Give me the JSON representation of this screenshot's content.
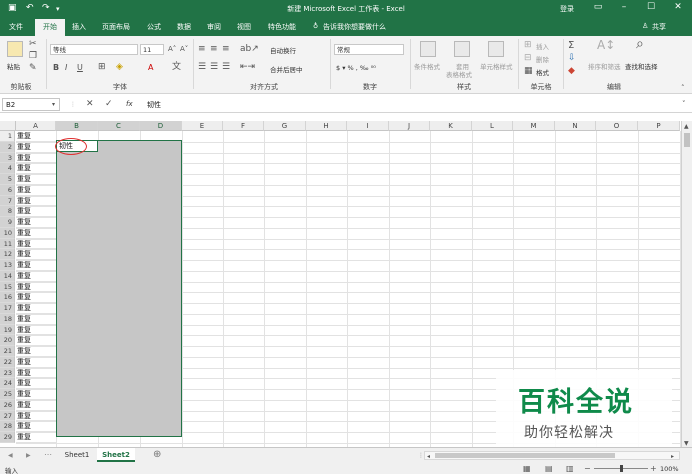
{
  "window": {
    "title": "新建 Microsoft Excel 工作表 - Excel",
    "login": "登录",
    "share": "共享"
  },
  "tabs": [
    "文件",
    "开始",
    "插入",
    "页面布局",
    "公式",
    "数据",
    "审阅",
    "视图",
    "特色功能"
  ],
  "active_tab": "开始",
  "tell_me": "告诉我你想要做什么",
  "ribbon": {
    "clipboard": {
      "paste": "粘贴",
      "label": "剪贴板"
    },
    "font": {
      "name": "等线",
      "size": "11",
      "label": "字体"
    },
    "alignment": {
      "wrap": "自动换行",
      "merge": "合并后居中",
      "label": "对齐方式"
    },
    "number": {
      "format": "常规",
      "label": "数字"
    },
    "styles": {
      "conditional": "条件格式",
      "table": "套用",
      "table2": "表格格式",
      "cell": "单元格样式",
      "label": "样式"
    },
    "cells": {
      "insert": "插入",
      "delete": "删除",
      "format": "格式",
      "label": "单元格"
    },
    "editing": {
      "sort": "排序和筛选",
      "find": "查找和选择",
      "label": "编辑"
    }
  },
  "formula_bar": {
    "name_box": "B2",
    "fx": "fx",
    "content": "韧性"
  },
  "columns": [
    "A",
    "B",
    "C",
    "D",
    "E",
    "F",
    "G",
    "H",
    "I",
    "J",
    "K",
    "L",
    "M",
    "N",
    "O",
    "P"
  ],
  "rows": [
    "1",
    "2",
    "3",
    "4",
    "5",
    "6",
    "7",
    "8",
    "9",
    "10",
    "11",
    "12",
    "13",
    "14",
    "15",
    "16",
    "17",
    "18",
    "19",
    "20",
    "21",
    "22",
    "23",
    "24",
    "25",
    "26",
    "27",
    "28",
    "29"
  ],
  "column_a_values": [
    "重复",
    "重复",
    "重复",
    "重复",
    "重复",
    "重复",
    "重复",
    "重复",
    "重复",
    "重复",
    "重复",
    "重复",
    "重复",
    "重复",
    "重复",
    "重复",
    "重复",
    "重复",
    "重复",
    "重复",
    "重复",
    "重复",
    "重复",
    "重复",
    "重复",
    "重复",
    "重复",
    "重复",
    "重复"
  ],
  "active_cell_value": "韧性",
  "sheets": [
    "Sheet1",
    "Sheet2"
  ],
  "active_sheet": "Sheet2",
  "status": {
    "mode": "输入",
    "zoom": "100%"
  },
  "watermark": {
    "title": "百科全说",
    "subtitle": "助你轻松解决"
  },
  "colors": {
    "accent": "#217346",
    "selection": "#c6c6c6",
    "highlight_circle": "#e03030",
    "watermark": "#0f8a4a"
  }
}
